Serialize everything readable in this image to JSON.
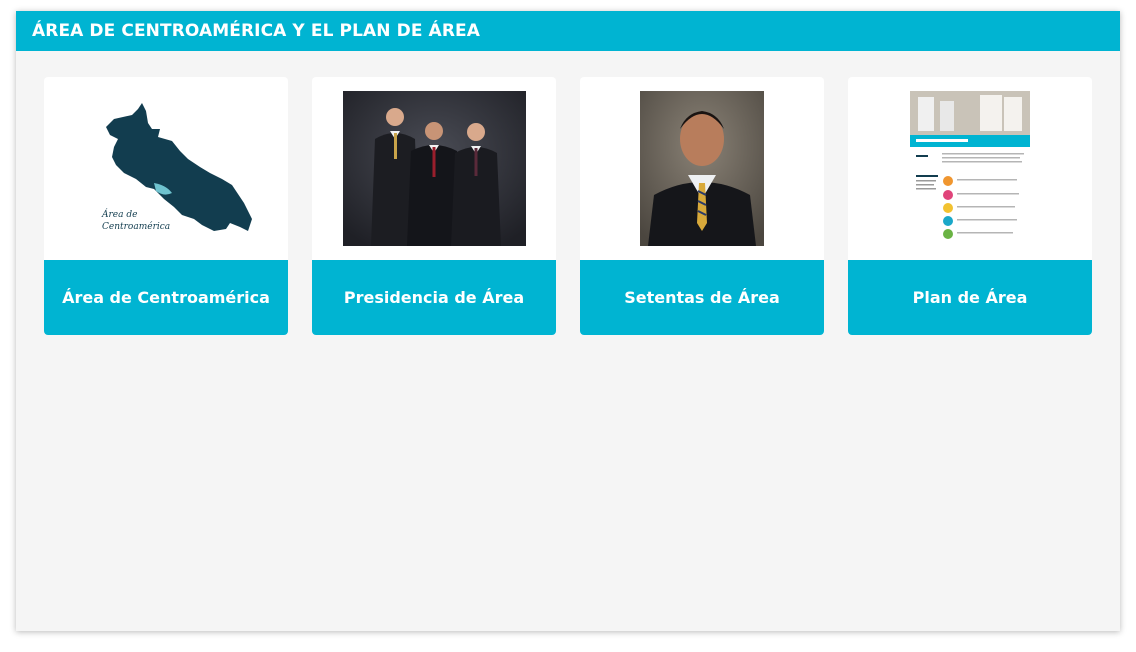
{
  "header": {
    "title": "ÁREA DE CENTROAMÉRICA Y EL PLAN DE ÁREA"
  },
  "cards": [
    {
      "label": "Área de Centroamérica",
      "image": "map-of-central-america",
      "map_caption_line1": "Área de",
      "map_caption_line2": "Centroamérica"
    },
    {
      "label": "Presidencia de Área",
      "image": "photo-of-three-men-in-suits"
    },
    {
      "label": "Setentas de Área",
      "image": "portrait-of-man-in-suit"
    },
    {
      "label": "Plan de Área",
      "image": "area-plan-document-thumbnail"
    }
  ],
  "colors": {
    "accent": "#00b4d2",
    "panel_bg": "#f5f5f5",
    "map_fill": "#123d4f"
  }
}
